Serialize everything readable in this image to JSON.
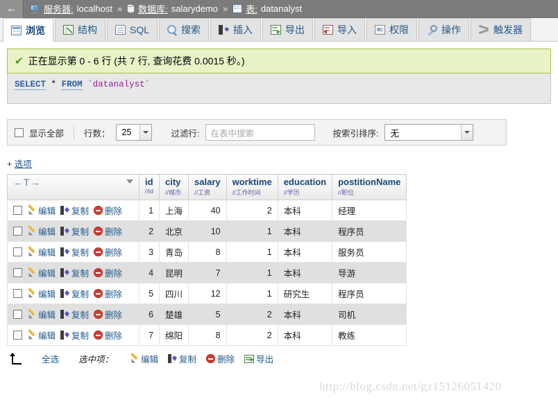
{
  "breadcrumb": {
    "back_icon": "back-arrow-icon",
    "items": [
      {
        "icon": "server-icon",
        "label": "服务器:",
        "value": "localhost"
      },
      {
        "icon": "database-icon",
        "label": "数据库:",
        "value": "salarydemo"
      },
      {
        "icon": "table-icon",
        "label": "表:",
        "value": "datanalyst"
      }
    ],
    "separator": "»"
  },
  "tabs": [
    {
      "label": "浏览",
      "icon": "browse-icon",
      "active": true
    },
    {
      "label": "结构",
      "icon": "structure-icon",
      "active": false
    },
    {
      "label": "SQL",
      "icon": "sql-icon",
      "active": false
    },
    {
      "label": "搜索",
      "icon": "search-icon",
      "active": false
    },
    {
      "label": "插入",
      "icon": "insert-icon",
      "active": false
    },
    {
      "label": "导出",
      "icon": "export-icon",
      "active": false
    },
    {
      "label": "导入",
      "icon": "import-icon",
      "active": false
    },
    {
      "label": "权限",
      "icon": "privileges-icon",
      "active": false
    },
    {
      "label": "操作",
      "icon": "operations-icon",
      "active": false
    },
    {
      "label": "触发器",
      "icon": "triggers-icon",
      "active": false
    }
  ],
  "status": {
    "icon": "check-icon",
    "message": "正在显示第 0 - 6 行 (共 7 行, 查询花费 0.0015 秒。)"
  },
  "sql": {
    "keyword1": "SELECT",
    "star": "*",
    "keyword2": "FROM",
    "identifier": "`datanalyst`"
  },
  "toolbar": {
    "show_all_label": "显示全部",
    "rows_label": "行数：",
    "rows_value": "25",
    "filter_label": "过滤行:",
    "filter_placeholder": "在表中搜索",
    "filter_value": "",
    "sort_label": "按索引排序:",
    "sort_value": "无"
  },
  "options_link": {
    "plus": "+",
    "label": "选项"
  },
  "table": {
    "sort_header": "←T→",
    "columns": [
      {
        "name": "id",
        "comment": "//id",
        "numeric": true
      },
      {
        "name": "city",
        "comment": "//城市",
        "numeric": false
      },
      {
        "name": "salary",
        "comment": "//工资",
        "numeric": true
      },
      {
        "name": "worktime",
        "comment": "//工作时间",
        "numeric": true
      },
      {
        "name": "education",
        "comment": "//学历",
        "numeric": false
      },
      {
        "name": "postitionName",
        "comment": "//职位",
        "numeric": false
      }
    ],
    "row_actions": [
      {
        "label": "编辑",
        "icon": "pencil-icon"
      },
      {
        "label": "复制",
        "icon": "copy-icon"
      },
      {
        "label": "删除",
        "icon": "delete-icon"
      }
    ],
    "rows": [
      {
        "id": "1",
        "city": "上海",
        "salary": "40",
        "worktime": "2",
        "education": "本科",
        "postitionName": "经理"
      },
      {
        "id": "2",
        "city": "北京",
        "salary": "10",
        "worktime": "1",
        "education": "本科",
        "postitionName": "程序员"
      },
      {
        "id": "3",
        "city": "青岛",
        "salary": "8",
        "worktime": "1",
        "education": "本科",
        "postitionName": "服务员"
      },
      {
        "id": "4",
        "city": "昆明",
        "salary": "7",
        "worktime": "1",
        "education": "本科",
        "postitionName": "导游"
      },
      {
        "id": "5",
        "city": "四川",
        "salary": "12",
        "worktime": "1",
        "education": "研究生",
        "postitionName": "程序员"
      },
      {
        "id": "6",
        "city": "楚雄",
        "salary": "5",
        "worktime": "2",
        "education": "本科",
        "postitionName": "司机"
      },
      {
        "id": "7",
        "city": "绵阳",
        "salary": "8",
        "worktime": "2",
        "education": "本科",
        "postitionName": "教练"
      }
    ]
  },
  "footer": {
    "select_all_label": "全选",
    "with_selected_label": "选中项：",
    "actions": [
      {
        "label": "编辑",
        "icon": "pencil-icon"
      },
      {
        "label": "复制",
        "icon": "copy-icon"
      },
      {
        "label": "删除",
        "icon": "delete-icon"
      },
      {
        "label": "导出",
        "icon": "export-icon"
      }
    ]
  },
  "watermark": "http://blog.csdn.net/gz15126051420",
  "colors": {
    "breadcrumb_bg": "#7b7b7b",
    "success_bg": "#e8f3c8",
    "success_border": "#a9c23f",
    "link": "#235a8a",
    "header_text": "#16477a",
    "comment_text": "#5a5fa8",
    "alt_row_bg": "#e0e0e0"
  }
}
